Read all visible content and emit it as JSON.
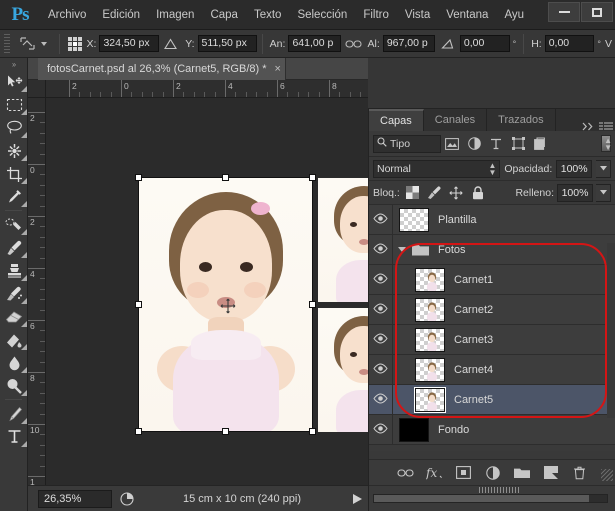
{
  "app": {
    "name": "Adobe Photoshop",
    "logo": "Ps"
  },
  "menubar": {
    "items": [
      {
        "label": "Archivo"
      },
      {
        "label": "Edición"
      },
      {
        "label": "Imagen"
      },
      {
        "label": "Capa"
      },
      {
        "label": "Texto"
      },
      {
        "label": "Selección"
      },
      {
        "label": "Filtro"
      },
      {
        "label": "Vista"
      },
      {
        "label": "Ventana"
      },
      {
        "label": "Ayu"
      }
    ]
  },
  "window_controls": {
    "minimize": "minimize-icon",
    "maximize": "maximize-icon"
  },
  "options_bar": {
    "tool_icon": "move-tool-icon",
    "reference_point_icon": "reference-point-grid-icon",
    "x_label": "X:",
    "x_value": "324,50 px",
    "delta_icon": "delta-triangle-icon",
    "y_label": "Y:",
    "y_value": "511,50 px",
    "w_label": "An:",
    "w_value": "641,00 p",
    "link_icon": "link-chain-icon",
    "h_label": "Al:",
    "h_value": "967,00 p",
    "rotate_icon": "rotate-angle-icon",
    "rotate_value": "0,00",
    "rotate_unit": "°",
    "skew_label": "H:",
    "skew_value": "0,00",
    "skew_unit": "°",
    "trailing_label": "V"
  },
  "toolbox": {
    "tools": [
      {
        "name": "move-tool-icon"
      },
      {
        "name": "rectangular-marquee-tool-icon"
      },
      {
        "name": "lasso-tool-icon"
      },
      {
        "name": "magic-wand-tool-icon"
      },
      {
        "name": "crop-tool-icon"
      },
      {
        "name": "eyedropper-tool-icon"
      },
      {
        "name": "healing-brush-tool-icon"
      },
      {
        "name": "brush-tool-icon"
      },
      {
        "name": "clone-stamp-tool-icon"
      },
      {
        "name": "history-brush-tool-icon"
      },
      {
        "name": "eraser-tool-icon"
      },
      {
        "name": "gradient-tool-icon"
      },
      {
        "name": "blur-tool-icon"
      },
      {
        "name": "dodge-tool-icon"
      },
      {
        "name": "pen-tool-icon"
      },
      {
        "name": "type-tool-icon"
      }
    ]
  },
  "document": {
    "tab_title": "fotosCarnet.psd al 26,3% (Carnet5, RGB/8) *",
    "close_label": "×"
  },
  "rulers": {
    "horizontal_labels": [
      "2",
      "0",
      "2",
      "4",
      "6",
      "8"
    ],
    "vertical_labels": [
      "2",
      "0",
      "2",
      "4",
      "6",
      "8",
      "10",
      "1"
    ]
  },
  "status_bar": {
    "zoom": "26,35%",
    "doc_icon": "document-info-icon",
    "info": "15 cm x 10 cm (240 ppi)",
    "arrow_icon": "play-arrow-icon"
  },
  "panel": {
    "tabs": [
      {
        "label": "Capas",
        "active": true
      },
      {
        "label": "Canales",
        "active": false
      },
      {
        "label": "Trazados",
        "active": false
      }
    ],
    "collapse_icon": "double-chevron-right-icon",
    "menu_icon": "panel-menu-icon",
    "filter": {
      "search_icon": "search-icon",
      "type_label": "Tipo",
      "stepper_icon": "updown-stepper-icon",
      "icons": [
        {
          "name": "filter-pixel-icon"
        },
        {
          "name": "filter-adjustment-icon"
        },
        {
          "name": "filter-type-icon"
        },
        {
          "name": "filter-shape-icon"
        },
        {
          "name": "filter-smartobject-icon"
        }
      ],
      "toggle_icon": "filter-power-toggle-icon"
    },
    "blend": {
      "mode": "Normal",
      "opacity_label": "Opacidad:",
      "opacity_value": "100%"
    },
    "lock": {
      "label": "Bloq.:",
      "icons": [
        {
          "name": "lock-transparent-pixels-icon"
        },
        {
          "name": "lock-image-pixels-icon"
        },
        {
          "name": "lock-position-icon"
        },
        {
          "name": "lock-all-icon"
        }
      ],
      "fill_label": "Relleno:",
      "fill_value": "100%"
    },
    "layers": [
      {
        "name": "Plantilla",
        "visible": true,
        "selected": false,
        "group": false,
        "child": false,
        "thumb": "transparent"
      },
      {
        "name": "Fotos",
        "visible": true,
        "selected": false,
        "group": true,
        "child": false,
        "thumb": "folder"
      },
      {
        "name": "Carnet1",
        "visible": true,
        "selected": false,
        "group": false,
        "child": true,
        "thumb": "photo"
      },
      {
        "name": "Carnet2",
        "visible": true,
        "selected": false,
        "group": false,
        "child": true,
        "thumb": "photo"
      },
      {
        "name": "Carnet3",
        "visible": true,
        "selected": false,
        "group": false,
        "child": true,
        "thumb": "photo"
      },
      {
        "name": "Carnet4",
        "visible": true,
        "selected": false,
        "group": false,
        "child": true,
        "thumb": "photo"
      },
      {
        "name": "Carnet5",
        "visible": true,
        "selected": true,
        "group": false,
        "child": true,
        "thumb": "photo-selected"
      },
      {
        "name": "Fondo",
        "visible": true,
        "selected": false,
        "group": false,
        "child": false,
        "thumb": "black"
      }
    ],
    "bottom_buttons": [
      {
        "name": "link-layers-button",
        "icon": "link-chain-icon"
      },
      {
        "name": "layer-style-button",
        "icon": "fx-icon"
      },
      {
        "name": "layer-mask-button",
        "icon": "mask-icon"
      },
      {
        "name": "adjustment-layer-button",
        "icon": "half-circle-icon"
      },
      {
        "name": "new-group-button",
        "icon": "folder-icon"
      },
      {
        "name": "new-layer-button",
        "icon": "new-layer-icon"
      },
      {
        "name": "delete-layer-button",
        "icon": "trash-icon"
      }
    ]
  },
  "annotation": {
    "shape": "red-oval-highlight",
    "color": "#d41515"
  },
  "colors": {
    "accent": "#38a7e0",
    "panel_bg": "#393939",
    "row_bg": "#3d3d3d",
    "selected_row": "#4c5568",
    "canvas_bg": "#2b2b2b",
    "annotation_red": "#d41515"
  }
}
